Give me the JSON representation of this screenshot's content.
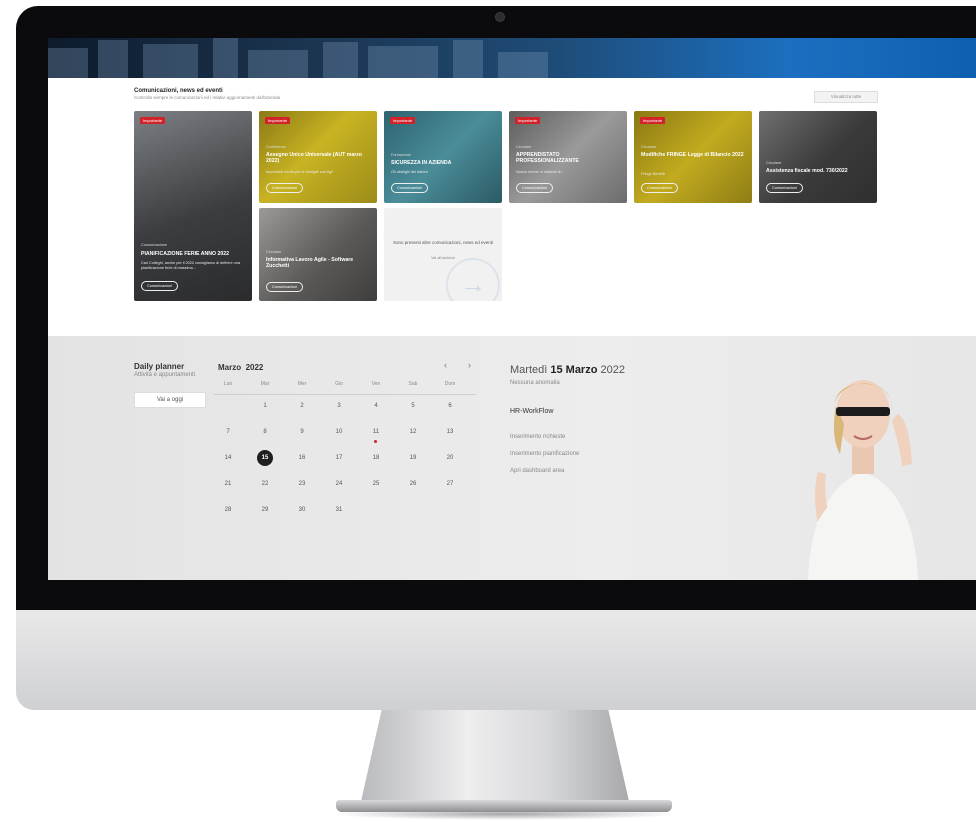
{
  "communications": {
    "title": "Comunicazioni, news ed eventi",
    "subtitle": "Controlla sempre le comunicazioni ed i relativi aggiornamenti dall'azienda",
    "show_all": "Visualizza tutte",
    "cards": [
      {
        "tag": "Importante",
        "category": "Comunicazione",
        "title": "PIANIFICAZIONE FERIE ANNO 2022",
        "desc": "Cari Colleghi, anche per il 2022 consigliamo di definire una pianificazione ferie di massima...",
        "button": "Comunicazioni",
        "bg": "#4d4f52"
      },
      {
        "tag": "Importante",
        "category": "Conferenza",
        "title": "Assegno Unico Universale (AUT marzo 2022)",
        "desc": "Importanti novità per le famiglie con figli",
        "button": "Comunicazioni",
        "bg": "#b9a21b"
      },
      {
        "tag": "Importante",
        "category": "Formazione",
        "title": "SICUREZZA IN AZIENDA",
        "desc": "Gli obblighi del datore",
        "button": "Comunicazioni",
        "bg": "#3f7f8c"
      },
      {
        "tag": "Importante",
        "category": "Circolare",
        "title": "APPRENDISTATO PROFESSIONALIZZANTE",
        "desc": "Nuove norme in materia di...",
        "button": "Comunicazioni",
        "bg": "#7a7a7a"
      },
      {
        "tag": "Importante",
        "category": "Circolare",
        "title": "Modifiche FRINGE Legge di Bilancio 2022",
        "desc": "Fringe Benefit",
        "button": "Comunicazioni",
        "bg": "#b29a1a"
      },
      {
        "category": "Circolare",
        "title": "Assistenza fiscale mod. 730/2022",
        "desc": "",
        "button": "Comunicazioni",
        "bg": "#4a4a4a"
      },
      {
        "category": "Circolare",
        "title": "Informativa Lavoro Agile - Software Zucchetti",
        "desc": "",
        "button": "Comunicazioni",
        "bg": "#6c6b69"
      }
    ],
    "more": {
      "text": "Sono presenti altre comunicazioni, news ed eventi",
      "link": "Vai all'archivio"
    }
  },
  "planner": {
    "title": "Daily planner",
    "subtitle": "Attività e appuntamenti",
    "today_button": "Vai a oggi",
    "month": "Marzo",
    "year": "2022",
    "prev": "‹",
    "next": "›",
    "weekdays": [
      "Lun",
      "Mar",
      "Mer",
      "Gio",
      "Ven",
      "Sab",
      "Dom"
    ],
    "weeks": [
      [
        "",
        "1",
        "2",
        "3",
        "4",
        "5",
        "6"
      ],
      [
        "7",
        "8",
        "9",
        "10",
        "11",
        "12",
        "13"
      ],
      [
        "14",
        "15",
        "16",
        "17",
        "18",
        "19",
        "20"
      ],
      [
        "21",
        "22",
        "23",
        "24",
        "25",
        "26",
        "27"
      ],
      [
        "28",
        "29",
        "30",
        "31",
        "",
        "",
        ""
      ]
    ],
    "selected_day": "15",
    "event_day": "11",
    "accent_color": "#d2232a"
  },
  "detail": {
    "weekday": "Martedì",
    "day": "15 Marzo",
    "year": "2022",
    "no_events": "Nessuna anomalia",
    "section": "HR-WorkFlow",
    "links": [
      "Inserimento richieste",
      "Inserimento pianificazione",
      "Apri dashboard area"
    ]
  }
}
